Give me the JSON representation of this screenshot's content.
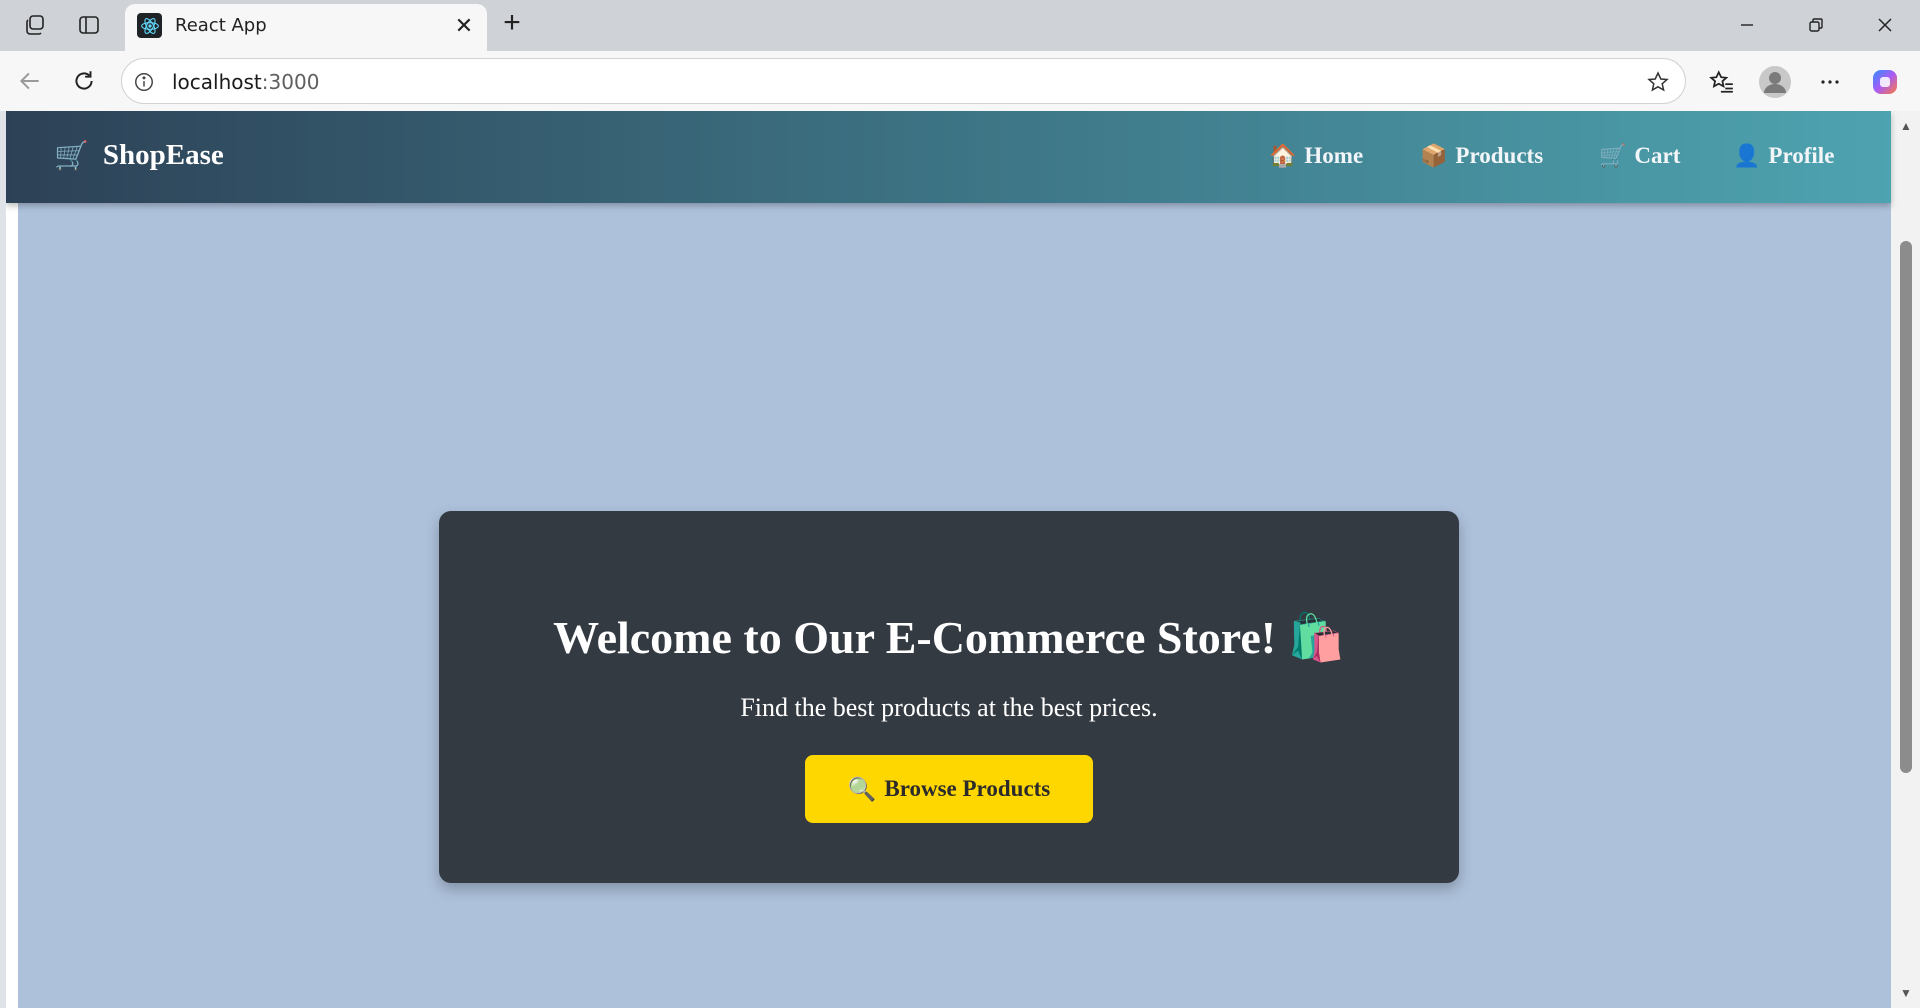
{
  "browser": {
    "tab": {
      "title": "React App",
      "favicon": "react-logo-icon"
    },
    "address": {
      "host": "localhost",
      "port": ":3000"
    }
  },
  "navbar": {
    "brand": {
      "icon": "🛒",
      "name": "ShopEase"
    },
    "links": [
      {
        "icon": "🏠",
        "label": "Home"
      },
      {
        "icon": "📦",
        "label": "Products"
      },
      {
        "icon": "🛒",
        "label": "Cart"
      },
      {
        "icon": "👤",
        "label": "Profile"
      }
    ]
  },
  "hero": {
    "title": "Welcome to Our E-Commerce Store! 🛍️",
    "subtitle": "Find the best products at the best prices.",
    "button": {
      "icon": "🔍",
      "label": "Browse Products"
    }
  },
  "colors": {
    "page_background": "#aec1db",
    "navbar_start": "#2d4156",
    "navbar_end": "#4ea3b0",
    "hero_card": "#343a42",
    "button": "#ffd700"
  }
}
